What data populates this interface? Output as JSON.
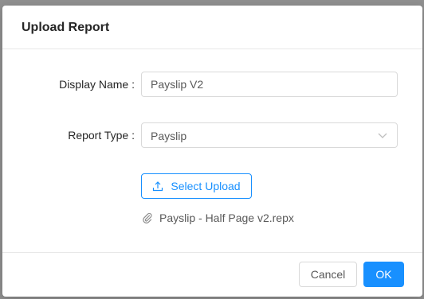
{
  "modal": {
    "title": "Upload Report"
  },
  "form": {
    "display_name_label": "Display Name :",
    "display_name_value": "Payslip V2",
    "report_type_label": "Report Type :",
    "report_type_value": "Payslip",
    "upload_button_label": "Select Upload",
    "uploaded_file_name": "Payslip - Half Page v2.repx"
  },
  "footer": {
    "cancel_label": "Cancel",
    "ok_label": "OK"
  },
  "colors": {
    "primary": "#1890ff",
    "border": "#d9d9d9",
    "text": "#262626"
  },
  "icons": {
    "upload": "upload-icon",
    "attachment": "paperclip-icon",
    "dropdown": "chevron-down-icon"
  }
}
